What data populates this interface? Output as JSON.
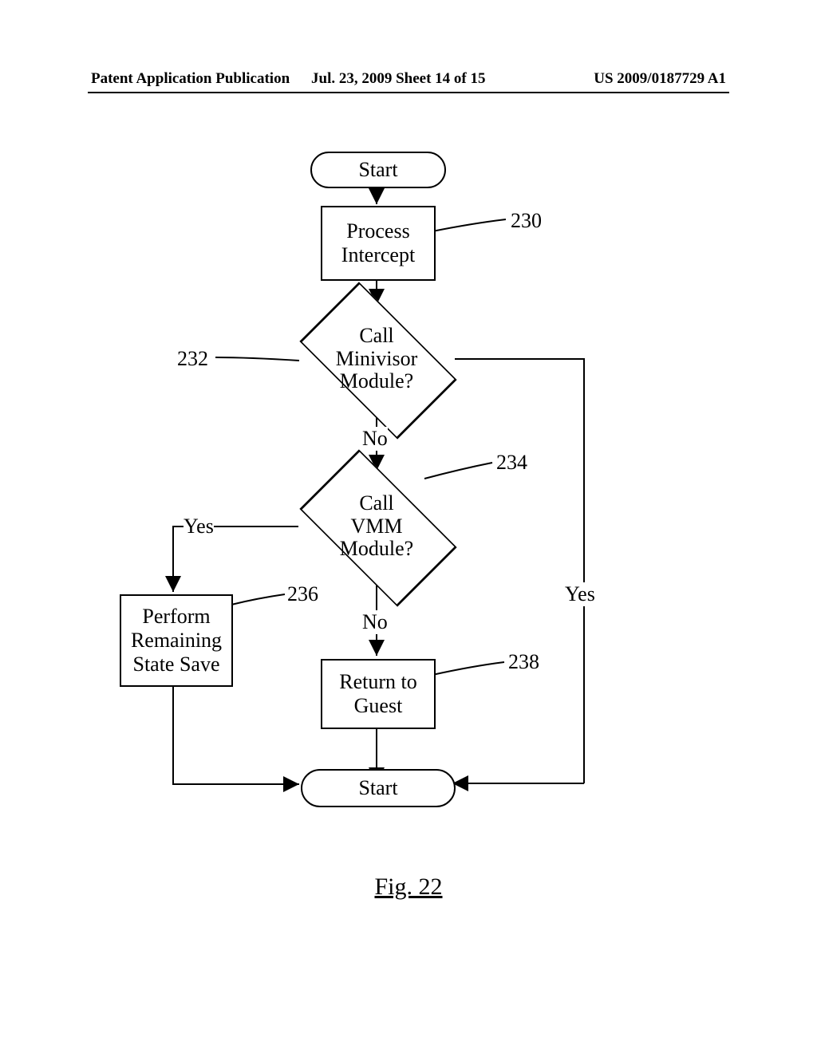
{
  "header": {
    "left": "Patent Application Publication",
    "mid": "Jul. 23, 2009  Sheet 14 of 15",
    "right": "US 2009/0187729 A1"
  },
  "figure_caption": "Fig. 22",
  "nodes": {
    "start_top": "Start",
    "process_intercept": "Process\nIntercept",
    "call_minivisor": "Call\nMinivisor\nModule?",
    "call_vmm": "Call\nVMM\nModule?",
    "perform_save": "Perform\nRemaining\nState Save",
    "return_guest": "Return to\nGuest",
    "start_bottom": "Start"
  },
  "refs": {
    "r230": "230",
    "r232": "232",
    "r234": "234",
    "r236": "236",
    "r238": "238"
  },
  "edge_labels": {
    "no1": "No",
    "no2": "No",
    "yes_left": "Yes",
    "yes_right": "Yes"
  }
}
